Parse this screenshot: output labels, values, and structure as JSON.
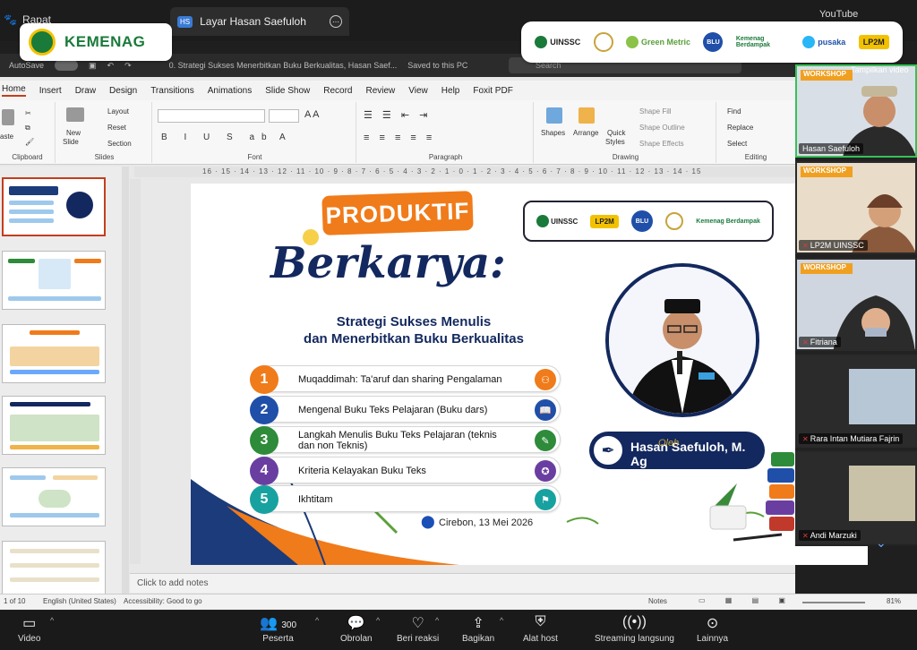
{
  "topbar": {
    "app_label": "Rapat",
    "share_tab_initials": "HS",
    "share_tab_title": "Layar Hasan Saefuloh",
    "right_label": "YouTube"
  },
  "overlay": {
    "left_brand": "KEMENAG",
    "partners": [
      "UINSSC",
      "Green Metric",
      "BLU",
      "Kemenag Berdampak",
      "pusaka",
      "LP2M"
    ]
  },
  "ppt": {
    "autosave_label": "AutoSave",
    "autosave_state": "Off",
    "doc_title": "0. Strategi Sukses Menerbitkan Buku Berkualitas, Hasan Saef...",
    "save_status": "Saved to this PC",
    "search_placeholder": "Search",
    "menu": [
      "Home",
      "Insert",
      "Draw",
      "Design",
      "Transitions",
      "Animations",
      "Slide Show",
      "Record",
      "Review",
      "View",
      "Help",
      "Foxit PDF"
    ],
    "ribbon": {
      "paste": "aste",
      "clipboard": "Clipboard",
      "new_slide": "New",
      "new_slide2": "Slide",
      "layout": "Layout",
      "reset": "Reset",
      "section": "Section",
      "slides": "Slides",
      "font": "Font",
      "paragraph": "Paragraph",
      "shapes": "Shapes",
      "arrange": "Arrange",
      "quick_styles": "Quick",
      "quick_styles2": "Styles",
      "shape_fill": "Shape Fill",
      "shape_outline": "Shape Outline",
      "shape_effects": "Shape Effects",
      "drawing": "Drawing",
      "find": "Find",
      "replace": "Replace",
      "select": "Select",
      "editing": "Editing"
    },
    "ruler_marks": "16 · 15 · 14 · 13 · 12 · 11 · 10 · 9 · 8 · 7 · 6 · 5 · 4 · 3 · 2 · 1 · 0 · 1 · 2 · 3 · 4 · 5 · 6 · 7 · 8 · 9 · 10 · 11 · 12 · 13 · 14 · 15",
    "notes_placeholder": "Click to add notes",
    "status": {
      "slide_count": "1 of 10",
      "language": "English (United States)",
      "accessibility": "Accessibility: Good to go",
      "notes": "Notes",
      "zoom": "81%"
    }
  },
  "slide": {
    "badge": "PRODUKTIF",
    "title": "Berkarya:",
    "subtitle_1": "Strategi Sukses Menulis",
    "subtitle_2": "dan Menerbitkan Buku Berkualitas",
    "agenda": [
      {
        "num": "1",
        "text": "Muqaddimah: Ta'aruf dan sharing Pengalaman",
        "color": "#f07b1a"
      },
      {
        "num": "2",
        "text": "Mengenal Buku Teks Pelajaran (Buku dars)",
        "color": "#1f4fa8"
      },
      {
        "num": "3",
        "text": "Langkah Menulis Buku Teks Pelajaran (teknis dan non Teknis)",
        "color": "#2e8b3a"
      },
      {
        "num": "4",
        "text": "Kriteria Kelayakan Buku Teks",
        "color": "#6a3ea1"
      },
      {
        "num": "5",
        "text": "Ikhtitam",
        "color": "#17a2a0"
      }
    ],
    "logos": [
      "UINSSC",
      "LP2M",
      "BLU",
      "Kemenag Berdampak"
    ],
    "oleh": "Oleh",
    "presenter": "Hasan Saefuloh, M. Ag",
    "date": "Cirebon, 13 Mei 2026"
  },
  "participants": {
    "show_video_label": "Tampilkan video",
    "tiles": [
      {
        "name": "Hasan Saefuloh",
        "banner": "WORKSHOP",
        "muted": false
      },
      {
        "name": "LP2M UINSSC",
        "banner": "WORKSHOP",
        "muted": true
      },
      {
        "name": "Fitriana",
        "banner": "WORKSHOP",
        "muted": true
      },
      {
        "name": "Rara Intan Mutiara Fajrin",
        "banner": "",
        "muted": true
      },
      {
        "name": "Andi Marzuki",
        "banner": "",
        "muted": true
      }
    ]
  },
  "toolbar": {
    "video": "Video",
    "participants": "Peserta",
    "participant_count": "300",
    "chat": "Obrolan",
    "reactions": "Beri reaksi",
    "share": "Bagikan",
    "host_tools": "Alat host",
    "streaming": "Streaming langsung",
    "more": "Lainnya"
  }
}
